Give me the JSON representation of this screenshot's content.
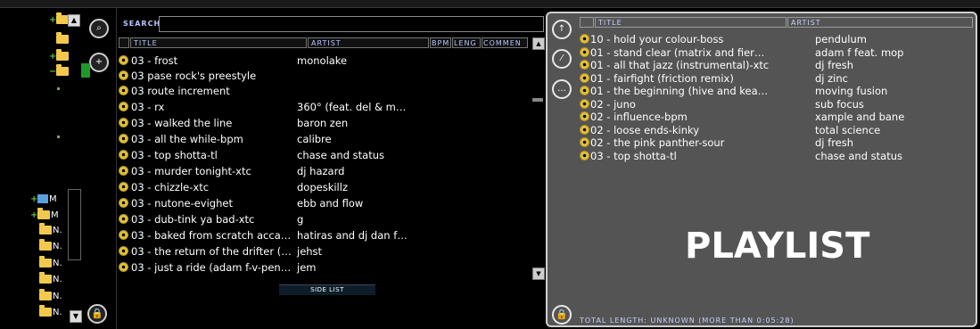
{
  "tree": {
    "items": [
      {
        "label": "M"
      },
      {
        "label": "M"
      },
      {
        "label": "N."
      },
      {
        "label": "N."
      },
      {
        "label": "N."
      },
      {
        "label": "N."
      },
      {
        "label": "N."
      },
      {
        "label": "N."
      }
    ]
  },
  "library": {
    "search_label": "SEARCH:",
    "search_value": "",
    "columns": [
      "TITLE",
      "ARTIST",
      "BPM",
      "LENG",
      "COMMEN"
    ],
    "side_list_label": "SIDE LIST",
    "tracks": [
      {
        "title": "03 - frost",
        "artist": "monolake"
      },
      {
        "title": "03 pase rock's preestyle",
        "artist": ""
      },
      {
        "title": "03 route increment",
        "artist": ""
      },
      {
        "title": "03 - rx",
        "artist": "360° (feat. del & m…"
      },
      {
        "title": "03 - walked the line",
        "artist": "baron zen"
      },
      {
        "title": "03 - all the while-bpm",
        "artist": "calibre"
      },
      {
        "title": "03 - top shotta-tl",
        "artist": "chase and status"
      },
      {
        "title": "03 - murder tonight-xtc",
        "artist": "dj hazard"
      },
      {
        "title": "03 - chizzle-xtc",
        "artist": "dopeskillz"
      },
      {
        "title": "03 - nutone-evighet",
        "artist": "ebb and flow"
      },
      {
        "title": "03 - dub-tink ya bad-xtc",
        "artist": "g"
      },
      {
        "title": "03 - baked from scratch  acca…",
        "artist": "hatiras and dj dan f…"
      },
      {
        "title": "03 - the return of the drifter (…",
        "artist": "jehst"
      },
      {
        "title": "03 - just a ride (adam f-v-pen…",
        "artist": "jem"
      }
    ]
  },
  "playlist": {
    "columns": [
      "TITLE",
      "ARTIST"
    ],
    "watermark": "PLAYLIST",
    "footer": "TOTAL LENGTH: UNKNOWN (MORE THAN 0:05:28)",
    "tracks": [
      {
        "title": "10 - hold your colour-boss",
        "artist": "pendulum"
      },
      {
        "title": "01 - stand clear (matrix and fier…",
        "artist": "adam f feat. mop"
      },
      {
        "title": "01 - all that jazz (instrumental)-xtc",
        "artist": "dj fresh"
      },
      {
        "title": "01 - fairfight (friction remix)",
        "artist": "dj zinc"
      },
      {
        "title": "01 - the beginning (hive and kea…",
        "artist": "moving fusion"
      },
      {
        "title": "02 - juno",
        "artist": "sub focus"
      },
      {
        "title": "02 - influence-bpm",
        "artist": "xample and bane"
      },
      {
        "title": "02 - loose ends-kinky",
        "artist": "total science"
      },
      {
        "title": "02 - the pink panther-sour",
        "artist": "dj fresh"
      },
      {
        "title": "03 - top shotta-tl",
        "artist": "chase and status"
      }
    ]
  },
  "colors": {
    "accent": "#b9c6ff",
    "playlist_bg": "#545454",
    "folder": "#f2c94c"
  }
}
